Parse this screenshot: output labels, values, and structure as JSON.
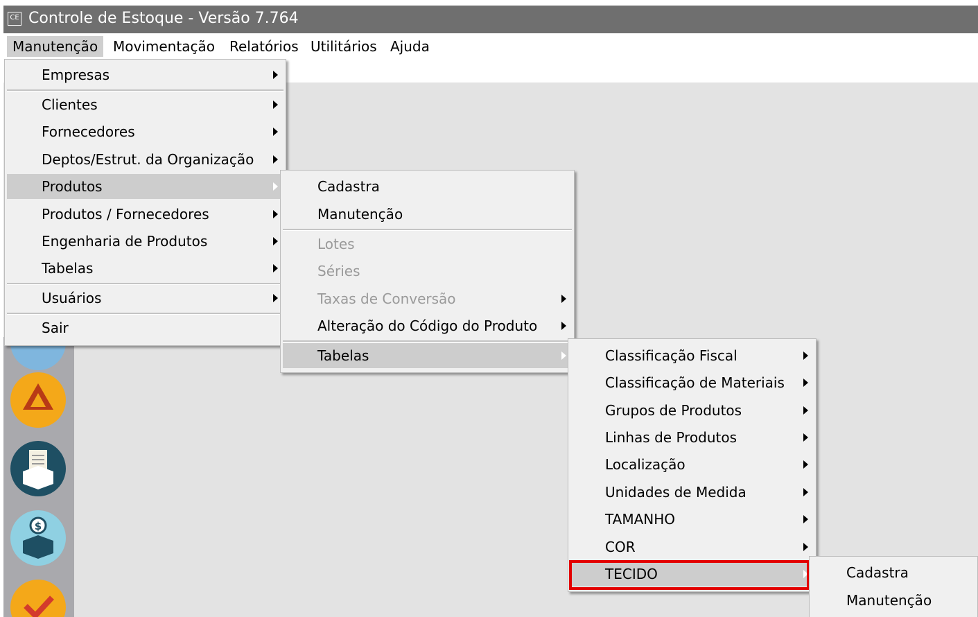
{
  "window": {
    "icon_text": "CE",
    "title": "Controle de Estoque - Versão 7.764"
  },
  "menubar": {
    "items": [
      "Manutenção",
      "Movimentação",
      "Relatórios",
      "Utilitários",
      "Ajuda"
    ],
    "active": "Manutenção"
  },
  "menu_manutencao": {
    "items": [
      "Empresas",
      "Clientes",
      "Fornecedores",
      "Deptos/Estrut. da Organização",
      "Produtos",
      "Produtos / Fornecedores",
      "Engenharia de Produtos",
      "Tabelas",
      "Usuários",
      "Sair"
    ],
    "highlighted": "Produtos"
  },
  "menu_produtos": {
    "items": [
      "Cadastra",
      "Manutenção",
      "Lotes",
      "Séries",
      "Taxas de Conversão",
      "Alteração do Código do Produto",
      "Tabelas"
    ],
    "disabled": [
      "Lotes",
      "Séries",
      "Taxas de Conversão"
    ],
    "highlighted": "Tabelas"
  },
  "menu_tabelas": {
    "items": [
      "Classificação Fiscal",
      "Classificação de Materiais",
      "Grupos de Produtos",
      "Linhas de Produtos",
      "Localização",
      "Unidades de Medida",
      "TAMANHO",
      "COR",
      "TECIDO"
    ],
    "highlighted": "TECIDO"
  },
  "menu_tecido": {
    "items": [
      "Cadastra",
      "Manutenção"
    ]
  },
  "sidebar_icons": [
    "cloud-icon",
    "drive-icon",
    "invoice-box-icon",
    "money-box-icon",
    "check-icon"
  ],
  "colors": {
    "titlebar": "#6f6f6f",
    "highlight": "#cdcdcd",
    "annotation": "#e30000",
    "sidebar": "#a9a9ad"
  }
}
